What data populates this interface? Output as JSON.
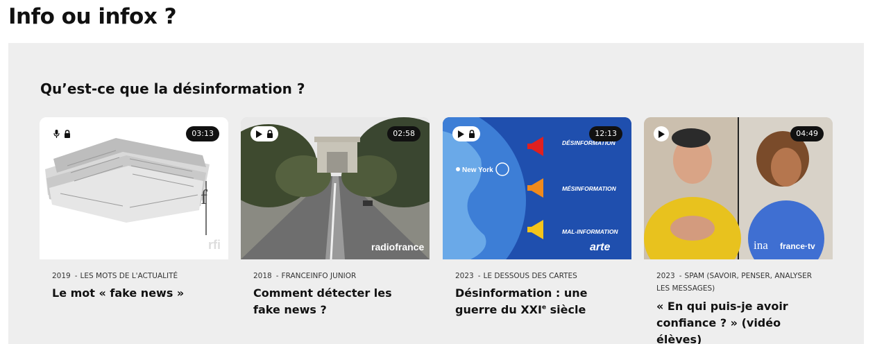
{
  "page": {
    "title": "Info ou infox ?"
  },
  "section": {
    "title": "Qu’est-ce que la désinformation ?"
  },
  "cards": [
    {
      "duration": "03:13",
      "year": "2019",
      "series": "LES MOTS DE L'ACTUALITÉ",
      "title": "Le mot « fake news »",
      "badges": [
        "microphone-icon",
        "lock-icon"
      ],
      "logo": "rfi"
    },
    {
      "duration": "02:58",
      "year": "2018",
      "series": "FRANCEINFO JUNIOR",
      "title": "Comment détecter les fake news ?",
      "badges": [
        "play-icon",
        "lock-icon"
      ],
      "logo": "radiofrance"
    },
    {
      "duration": "12:13",
      "year": "2023",
      "series": "LE DESSOUS DES CARTES",
      "title_main": "Désinformation : une guerre du XXI",
      "title_sup": "e",
      "title_end": " siècle",
      "badges": [
        "play-icon",
        "lock-icon"
      ],
      "logo": "arte",
      "labels": [
        "DÉSINFORMATION",
        "MÉSINFORMATION",
        "MAL-INFORMATION"
      ],
      "city": "New York"
    },
    {
      "duration": "04:49",
      "year": "2023",
      "series": "SPAM (SAVOIR, PENSER, ANALYSER LES MESSAGES)",
      "title": "« En qui puis-je avoir confiance ? » (vidéo élèves)",
      "badges": [
        "play-icon"
      ],
      "logo_left": "ina",
      "logo_right": "france·tv"
    }
  ],
  "colors": {
    "panel": "#eeeeee",
    "badge_dark": "#111111",
    "text": "#111111"
  }
}
